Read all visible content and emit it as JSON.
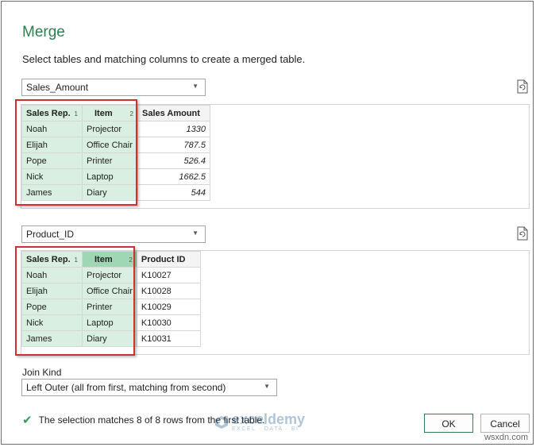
{
  "dialog": {
    "title": "Merge",
    "subtitle": "Select tables and matching columns to create a merged table."
  },
  "table1": {
    "select_value": "Sales_Amount",
    "columns": [
      "Sales Rep.",
      "Item",
      "Sales Amount"
    ],
    "column_order": [
      "1",
      "2"
    ],
    "rows": [
      [
        "Noah",
        "Projector",
        "1330"
      ],
      [
        "Elijah",
        "Office Chair",
        "787.5"
      ],
      [
        "Pope",
        "Printer",
        "526.4"
      ],
      [
        "Nick",
        "Laptop",
        "1662.5"
      ],
      [
        "James",
        "Diary",
        "544"
      ]
    ]
  },
  "table2": {
    "select_value": "Product_ID",
    "columns": [
      "Sales Rep.",
      "Item",
      "Product ID"
    ],
    "column_order": [
      "1",
      "2"
    ],
    "rows": [
      [
        "Noah",
        "Projector",
        "K10027"
      ],
      [
        "Elijah",
        "Office Chair",
        "K10028"
      ],
      [
        "Pope",
        "Printer",
        "K10029"
      ],
      [
        "Nick",
        "Laptop",
        "K10030"
      ],
      [
        "James",
        "Diary",
        "K10031"
      ]
    ]
  },
  "join": {
    "label": "Join Kind",
    "value": "Left Outer (all from first, matching from second)"
  },
  "status": {
    "text": "The selection matches 8 of 8 rows from the first table."
  },
  "buttons": {
    "ok": "OK",
    "cancel": "Cancel"
  },
  "watermark": {
    "name": "exceldemy",
    "tagline": "EXCEL · DATA · BI"
  },
  "site": "wsxdn.com",
  "colors": {
    "accent": "#2e7d4f",
    "selected_column": "#d9efe1",
    "highlight_box": "#d03030"
  }
}
